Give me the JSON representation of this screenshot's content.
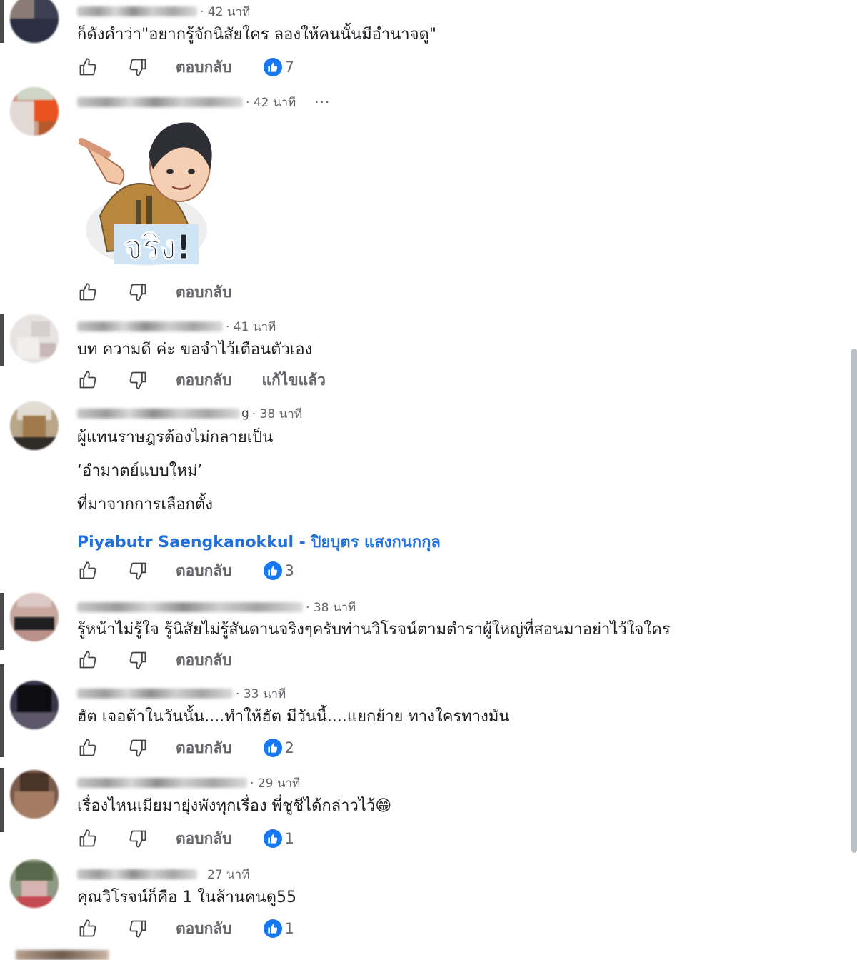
{
  "comments": [
    {
      "time": "42 นาที",
      "text": [
        "ก็ดังคำว่า\"อยากรู้จักนิสัยใคร ลองให้คนนั้นมีอำนาจดู\""
      ],
      "reply": "ตอบกลับ",
      "reactions": "7"
    },
    {
      "time": "42 นาที",
      "more": "···",
      "sticker_text": "จริง!",
      "reply": "ตอบกลับ"
    },
    {
      "time": "41 นาที",
      "text": [
        "บท ความดี ค่ะ ขอจำไว้เตือนตัวเอง"
      ],
      "reply": "ตอบกลับ",
      "edited": "แก้ไขแล้ว"
    },
    {
      "name_tail": "g",
      "time": "38 นาที",
      "text": [
        "ผู้แทนราษฎรต้องไม่กลายเป็น",
        "‘อำมาตย์แบบใหม่’",
        "ที่มาจากการเลือกตั้ง"
      ],
      "link": "Piyabutr Saengkanokkul - ปิยบุตร แสงกนกกุล",
      "reply": "ตอบกลับ",
      "reactions": "3"
    },
    {
      "time": "38 นาที",
      "text": [
        "รู้หน้าไม่รู้ใจ รู้นิสัยไม่รู้สันดานจริงๆครับท่านวิโรจน์ตามตำราผู้ใหญ่ที่สอนมาอย่าไว้ใจใคร"
      ],
      "reply": "ตอบกลับ"
    },
    {
      "time": "33 นาที",
      "text": [
        "ฮัต เจอต้าในวันนั้น....ทำให้ฮัต มีวันนี้....แยกย้าย ทางใครทางมัน"
      ],
      "reply": "ตอบกลับ",
      "reactions": "2"
    },
    {
      "time": "29 นาที",
      "text": [
        "เรื่องไหนเมียมายุ่งพังทุกเรื่อง พี่ชูชีได้กล่าวไว้😁"
      ],
      "reply": "ตอบกลับ",
      "reactions": "1"
    },
    {
      "time": "27 นาที",
      "text": [
        "คุณวิโรจน์ก็คือ 1 ในล้านคนดู55"
      ],
      "reply": "ตอบกลับ",
      "reactions": "1"
    }
  ],
  "colors": {
    "link": "#216fdb",
    "reaction_badge": "#1877f2",
    "muted_text": "#65676b"
  }
}
